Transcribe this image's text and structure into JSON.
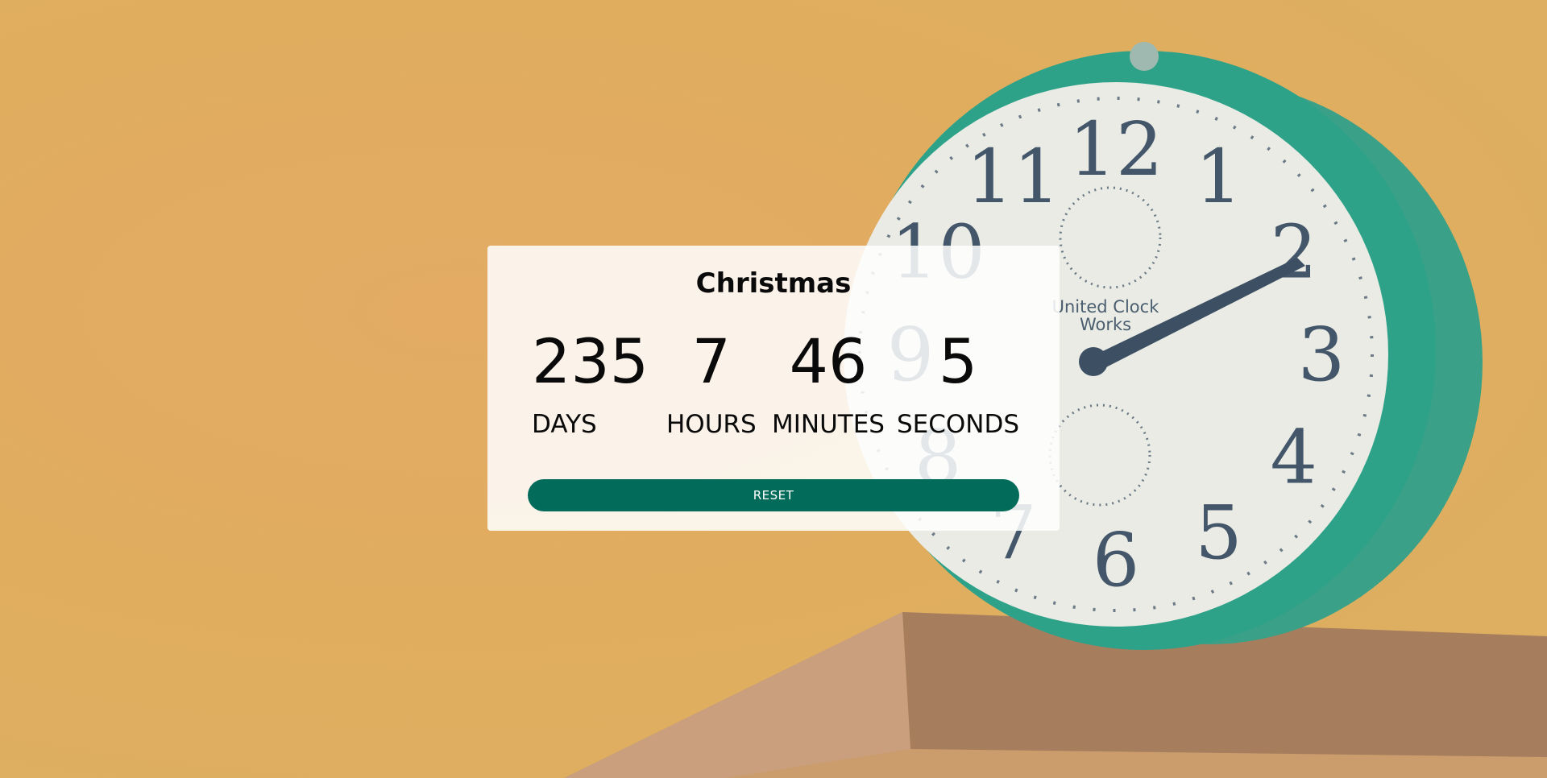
{
  "event": {
    "title": "Christmas"
  },
  "countdown": {
    "days": "235",
    "hours": "7",
    "minutes": "46",
    "seconds": "5",
    "days_label": "DAYS",
    "hours_label": "HOURS",
    "minutes_label": "MINUTES",
    "seconds_label": "SECONDS"
  },
  "actions": {
    "reset_label": "RESET"
  },
  "colors": {
    "background": "#e0ad5f",
    "button": "#036b5a",
    "clock_case": "#2aa58a"
  },
  "background": {
    "clock": {
      "brand_line_1": "United Clock",
      "brand_line_2": "Works",
      "numerals": [
        "12",
        "1",
        "2",
        "3",
        "4",
        "5",
        "6",
        "7",
        "8",
        "9",
        "10",
        "11"
      ]
    }
  }
}
